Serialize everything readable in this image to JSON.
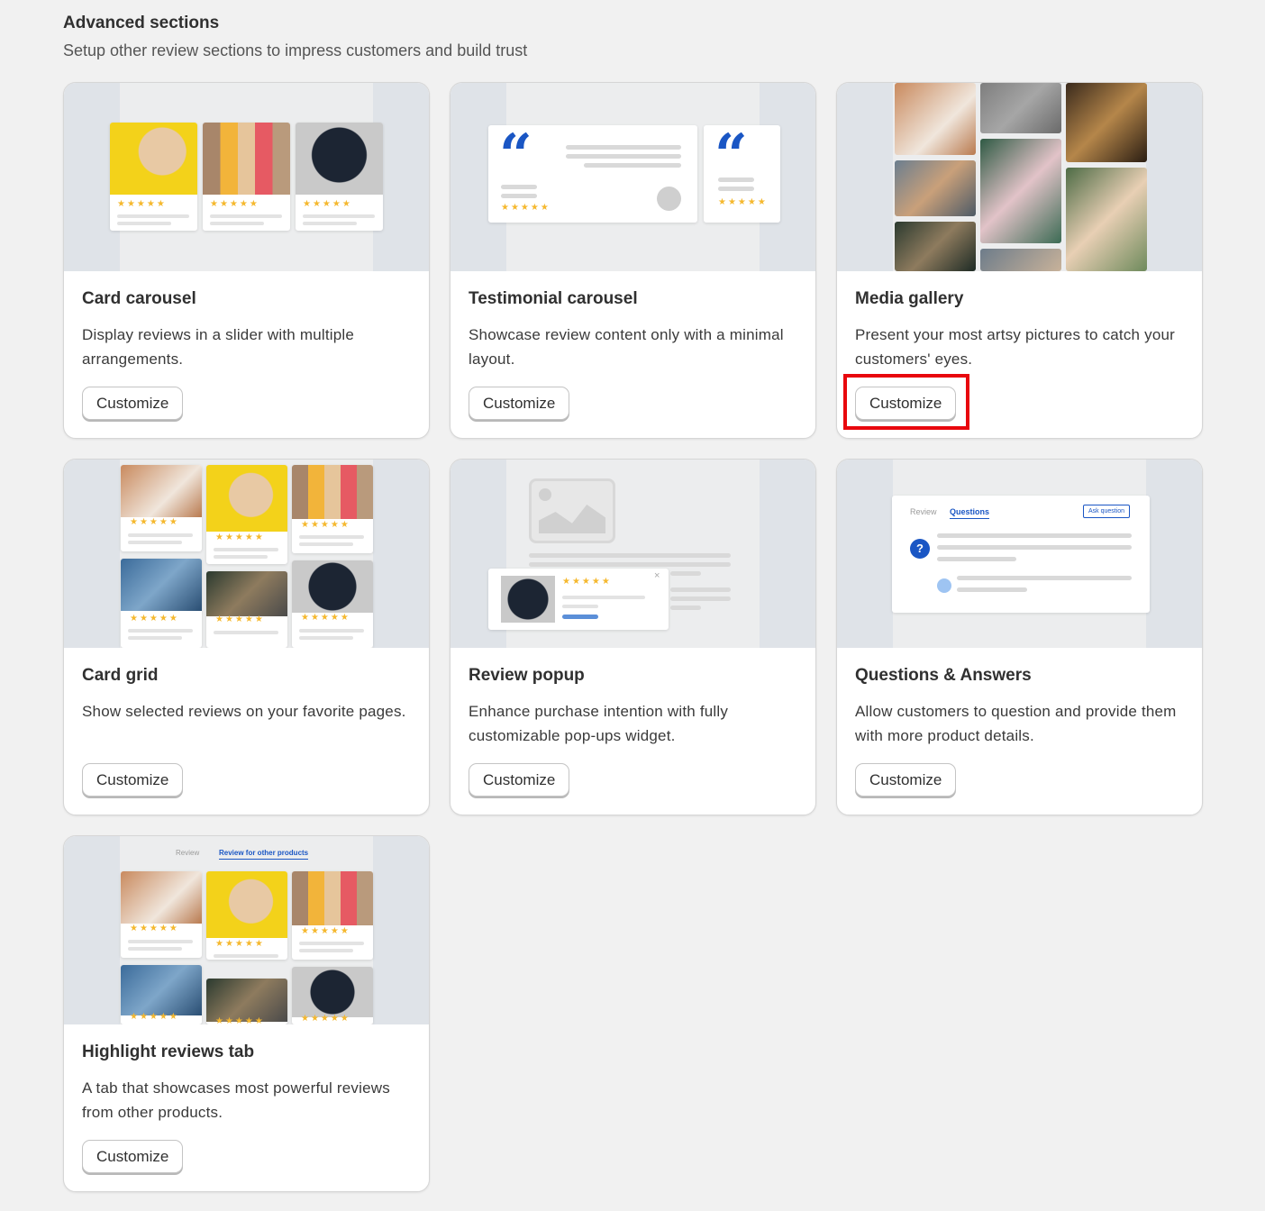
{
  "header": {
    "title": "Advanced sections",
    "subtitle": "Setup other review sections to impress customers and build trust"
  },
  "cards": [
    {
      "title": "Card carousel",
      "desc": "Display reviews in a slider with multiple arrangements.",
      "button": "Customize"
    },
    {
      "title": "Testimonial carousel",
      "desc": "Showcase review content only with a minimal layout.",
      "button": "Customize"
    },
    {
      "title": "Media gallery",
      "desc": "Present your most artsy pictures to catch your customers' eyes.",
      "button": "Customize"
    },
    {
      "title": "Card grid",
      "desc": "Show selected reviews on your favorite pages.",
      "button": "Customize"
    },
    {
      "title": "Review popup",
      "desc": "Enhance purchase intention with fully customizable pop-ups widget.",
      "button": "Customize"
    },
    {
      "title": "Questions & Answers",
      "desc": "Allow customers to question and provide them with more product details.",
      "button": "Customize"
    },
    {
      "title": "Highlight reviews tab",
      "desc": "A tab that showcases most powerful reviews from other products.",
      "button": "Customize"
    }
  ],
  "qa_preview": {
    "tab_review": "Review",
    "tab_questions": "Questions",
    "ask_button": "Ask question",
    "question_mark": "?"
  },
  "tab_preview": {
    "tab_review": "Review",
    "tab_other": "Review for other products"
  },
  "stars": "★★★★★",
  "quote_glyph": "“",
  "close_glyph": "×",
  "colors": {
    "accent": "#1a56c4",
    "star": "#f5b82e",
    "highlight": "#e8070d"
  }
}
